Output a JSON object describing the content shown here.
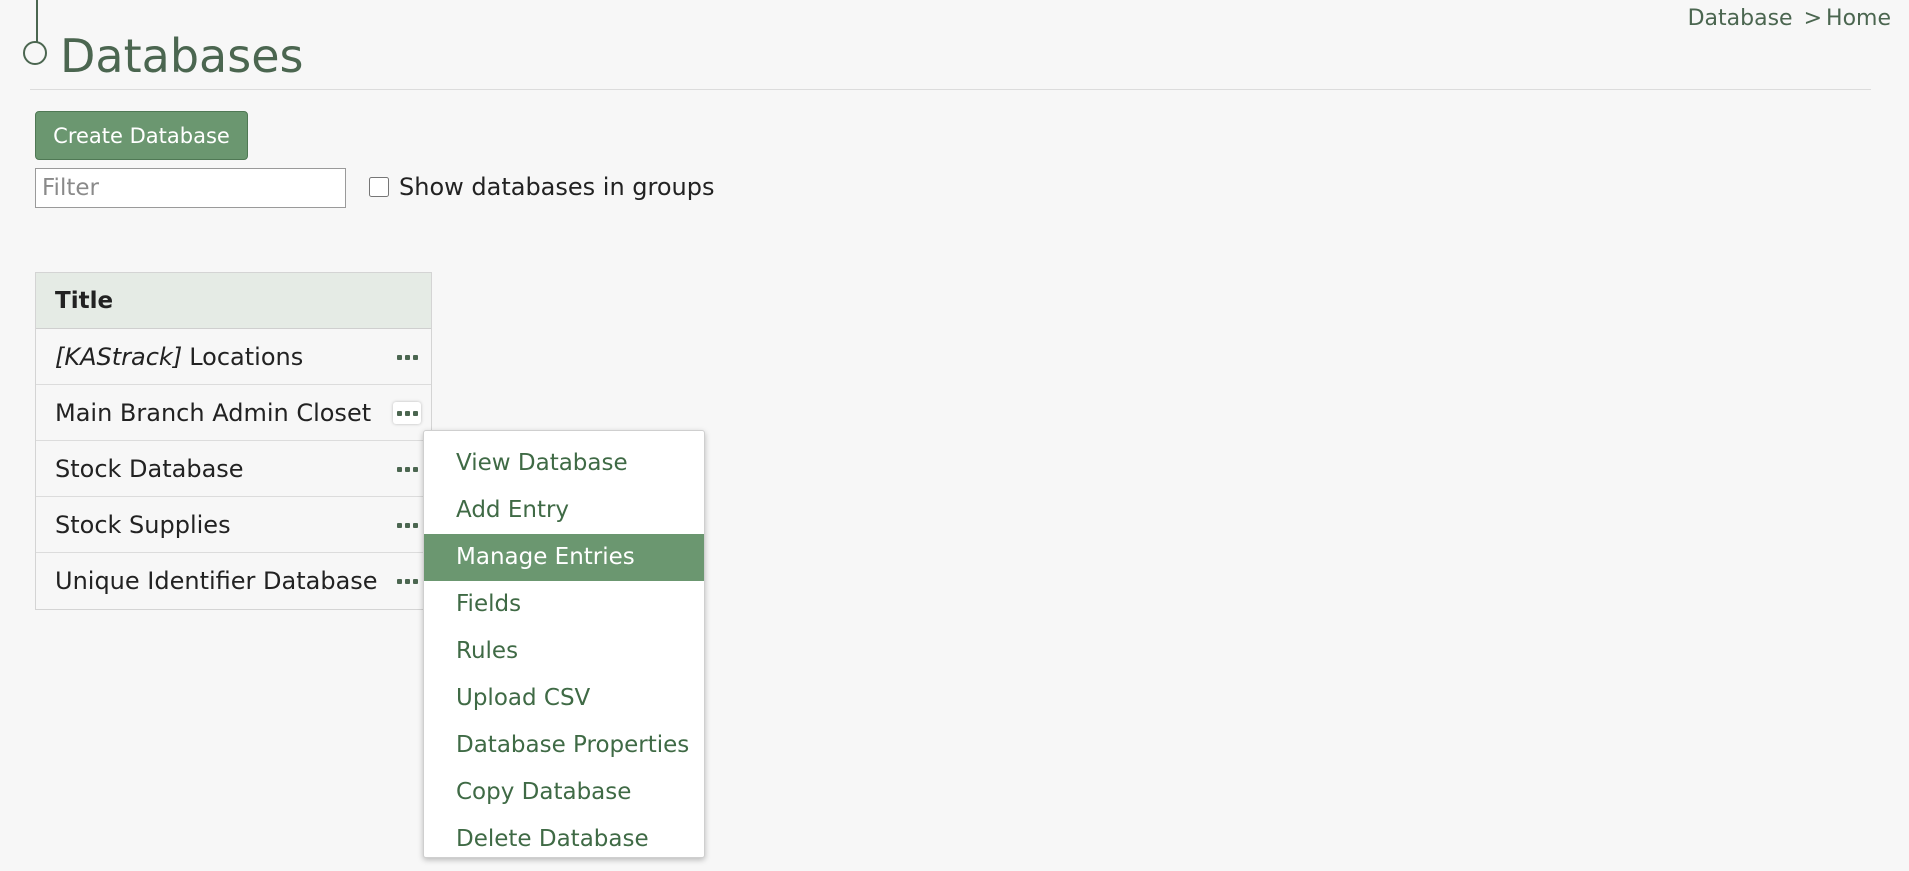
{
  "header": {
    "title": "Databases",
    "breadcrumb": {
      "parent": "Database",
      "separator": ">",
      "current": "Home"
    }
  },
  "toolbar": {
    "create_label": "Create Database",
    "filter_placeholder": "Filter",
    "filter_value": "",
    "groups_label": "Show databases in groups",
    "groups_checked": false
  },
  "table": {
    "header": "Title",
    "rows": [
      {
        "prefix": "[KAStrack]",
        "name": "Locations"
      },
      {
        "prefix": "",
        "name": "Main Branch Admin Closet"
      },
      {
        "prefix": "",
        "name": "Stock Database"
      },
      {
        "prefix": "",
        "name": "Stock Supplies"
      },
      {
        "prefix": "",
        "name": "Unique Identifier Database"
      }
    ],
    "more_icon": "ellipsis-icon"
  },
  "context_menu": {
    "open_for_row": "Main Branch Admin Closet",
    "highlighted": "Manage Entries",
    "items": [
      "View Database",
      "Add Entry",
      "Manage Entries",
      "Fields",
      "Rules",
      "Upload CSV",
      "Database Properties",
      "Copy Database",
      "Delete Database"
    ]
  },
  "colors": {
    "accent": "#6b9770",
    "accent_text": "#4b6650",
    "link": "#3f6a45",
    "table_header_bg": "#e5ebe5",
    "page_bg": "#f7f7f7"
  }
}
